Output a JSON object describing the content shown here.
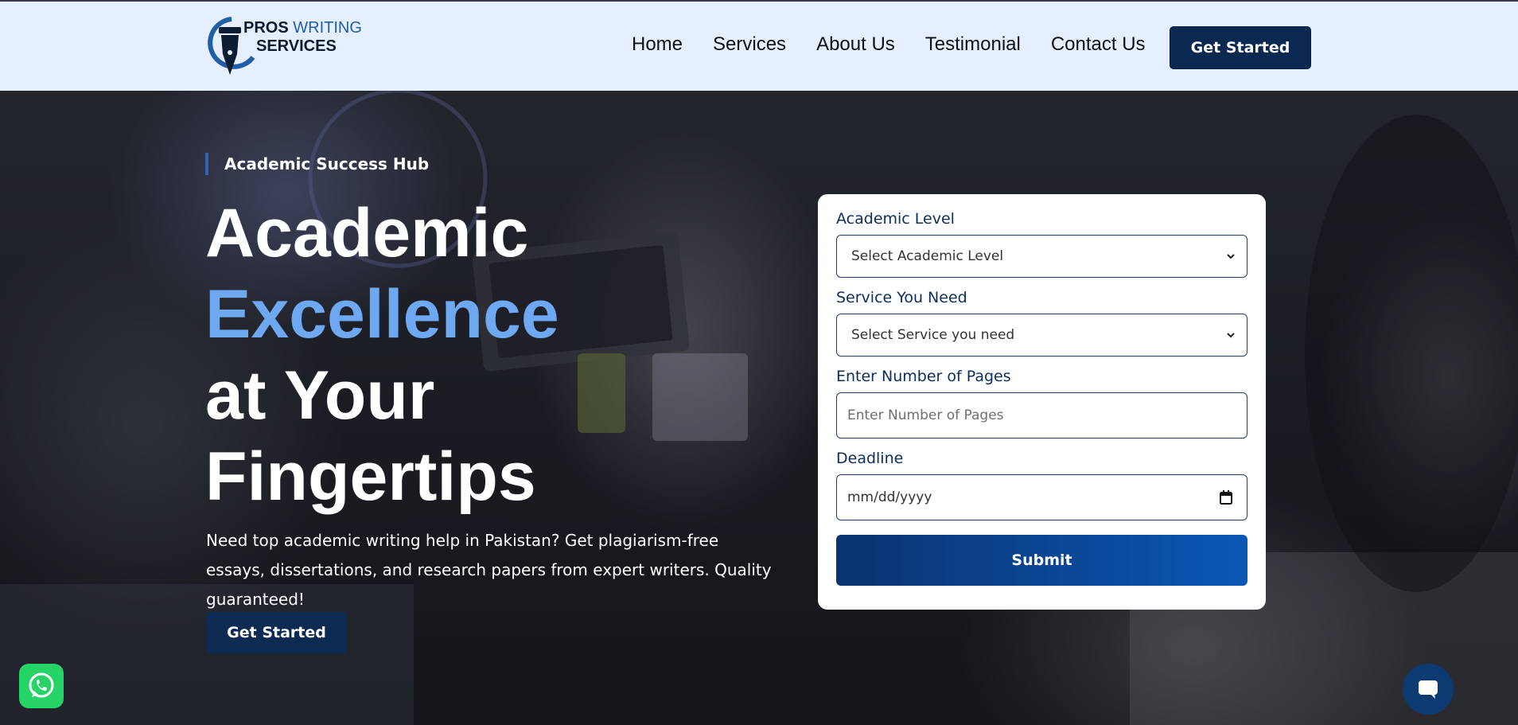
{
  "brand": {
    "pros": "PROS",
    "writing": "WRITING",
    "services": "SERVICES"
  },
  "nav": {
    "items": [
      "Home",
      "Services",
      "About Us",
      "Testimonial",
      "Contact Us"
    ],
    "cta": "Get Started"
  },
  "hero": {
    "kicker": "Academic Success Hub",
    "headline_line1": "Academic",
    "headline_accent": "Excellence",
    "headline_line3": "at Your",
    "headline_line4": "Fingertips",
    "description": "Need top academic writing help in Pakistan? Get plagiarism-free essays, dissertations, and research papers from expert writers. Quality guaranteed!",
    "cta": "Get Started"
  },
  "form": {
    "academic_level": {
      "label": "Academic Level",
      "value": "Select Academic Level"
    },
    "service": {
      "label": "Service You Need",
      "value": "Select Service you need"
    },
    "pages": {
      "label": "Enter Number of Pages",
      "placeholder": "Enter Number of Pages"
    },
    "deadline": {
      "label": "Deadline",
      "placeholder": "mm/dd/yyyy"
    },
    "submit": "Submit"
  },
  "icons": {
    "whatsapp": "whatsapp-icon",
    "chat": "chat-icon",
    "logo": "fountain-pen-icon"
  },
  "colors": {
    "navy": "#0a2850",
    "accent_blue": "#6ea8f0",
    "header_bg": "#e6efff",
    "whatsapp_green": "#25d366"
  }
}
